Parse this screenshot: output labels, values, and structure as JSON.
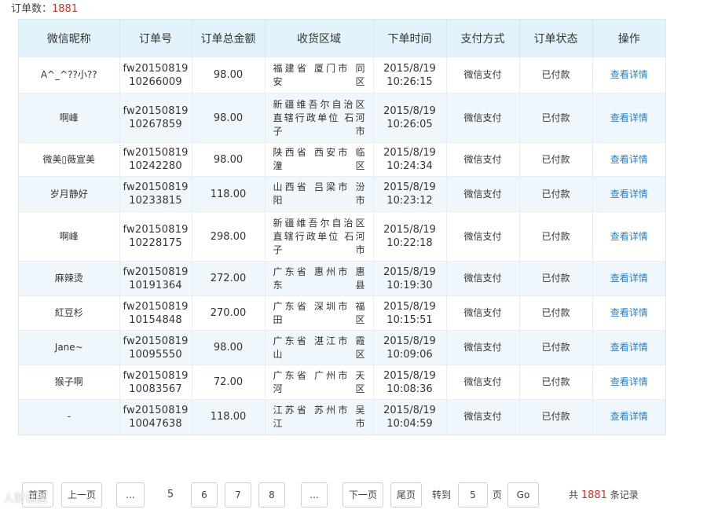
{
  "summary": {
    "label": "订单数：",
    "count": "1881"
  },
  "table": {
    "headers": [
      "微信昵称",
      "订单号",
      "订单总金额",
      "收货区域",
      "下单时间",
      "支付方式",
      "订单状态",
      "操作"
    ],
    "rows": [
      {
        "nick": "A^_^??小??",
        "order": [
          "fw20150819",
          "10266009"
        ],
        "amount": "98.00",
        "region": [
          "福建省 厦门市 同",
          "安区"
        ],
        "time": [
          "2015/8/19",
          "10:26:15"
        ],
        "pay": "微信支付",
        "status": "已付款",
        "action": "查看详情"
      },
      {
        "nick": "啊峰",
        "order": [
          "fw20150819",
          "10267859"
        ],
        "amount": "98.00",
        "region": [
          "新疆维吾尔自治区",
          "直辖行政单位 石河",
          "子市"
        ],
        "time": [
          "2015/8/19",
          "10:26:05"
        ],
        "pay": "微信支付",
        "status": "已付款",
        "action": "查看详情"
      },
      {
        "nick": "微美▯薇宣美",
        "order": [
          "fw20150819",
          "10242280"
        ],
        "amount": "98.00",
        "region": [
          "陕西省 西安市 临",
          "潼区"
        ],
        "time": [
          "2015/8/19",
          "10:24:34"
        ],
        "pay": "微信支付",
        "status": "已付款",
        "action": "查看详情"
      },
      {
        "nick": "岁月静好",
        "order": [
          "fw20150819",
          "10233815"
        ],
        "amount": "118.00",
        "region": [
          "山西省 吕梁市 汾",
          "阳市"
        ],
        "time": [
          "2015/8/19",
          "10:23:12"
        ],
        "pay": "微信支付",
        "status": "已付款",
        "action": "查看详情"
      },
      {
        "nick": "啊峰",
        "order": [
          "fw20150819",
          "10228175"
        ],
        "amount": "298.00",
        "region": [
          "新疆维吾尔自治区",
          "直辖行政单位 石河",
          "子市"
        ],
        "time": [
          "2015/8/19",
          "10:22:18"
        ],
        "pay": "微信支付",
        "status": "已付款",
        "action": "查看详情"
      },
      {
        "nick": "麻辣烫",
        "order": [
          "fw20150819",
          "10191364"
        ],
        "amount": "272.00",
        "region": [
          "广东省 惠州市 惠",
          "东县"
        ],
        "time": [
          "2015/8/19",
          "10:19:30"
        ],
        "pay": "微信支付",
        "status": "已付款",
        "action": "查看详情"
      },
      {
        "nick": "紅豆杉",
        "order": [
          "fw20150819",
          "10154848"
        ],
        "amount": "270.00",
        "region": [
          "广东省 深圳市 福",
          "田区"
        ],
        "time": [
          "2015/8/19",
          "10:15:51"
        ],
        "pay": "微信支付",
        "status": "已付款",
        "action": "查看详情"
      },
      {
        "nick": "Jane~",
        "order": [
          "fw20150819",
          "10095550"
        ],
        "amount": "98.00",
        "region": [
          "广东省 湛江市 霞",
          "山区"
        ],
        "time": [
          "2015/8/19",
          "10:09:06"
        ],
        "pay": "微信支付",
        "status": "已付款",
        "action": "查看详情"
      },
      {
        "nick": "猴子啊",
        "order": [
          "fw20150819",
          "10083567"
        ],
        "amount": "72.00",
        "region": [
          "广东省 广州市 天",
          "河区"
        ],
        "time": [
          "2015/8/19",
          "10:08:36"
        ],
        "pay": "微信支付",
        "status": "已付款",
        "action": "查看详情"
      },
      {
        "nick": "-",
        "order": [
          "fw20150819",
          "10047638"
        ],
        "amount": "118.00",
        "region": [
          "江苏省 苏州市 吴",
          "江市"
        ],
        "time": [
          "2015/8/19",
          "10:04:59"
        ],
        "pay": "微信支付",
        "status": "已付款",
        "action": "查看详情"
      }
    ]
  },
  "pager": {
    "first": "首页",
    "prev": "上一页",
    "ellipsis_left": "...",
    "current": "5",
    "pages": [
      "6",
      "7",
      "8"
    ],
    "ellipsis_right": "...",
    "next": "下一页",
    "last": "尾页",
    "goto_label": "转到",
    "goto_value": "5",
    "page_unit": "页",
    "go": "Go",
    "total_prefix": "共",
    "total_count": "1881",
    "total_suffix": "条记录"
  },
  "watermark": "人财话题",
  "colors": {
    "header_bg": "#e3f3fc",
    "stripe_bg": "#f0f7fc",
    "link": "#2a7fc1",
    "count_red": "#c0392b"
  }
}
